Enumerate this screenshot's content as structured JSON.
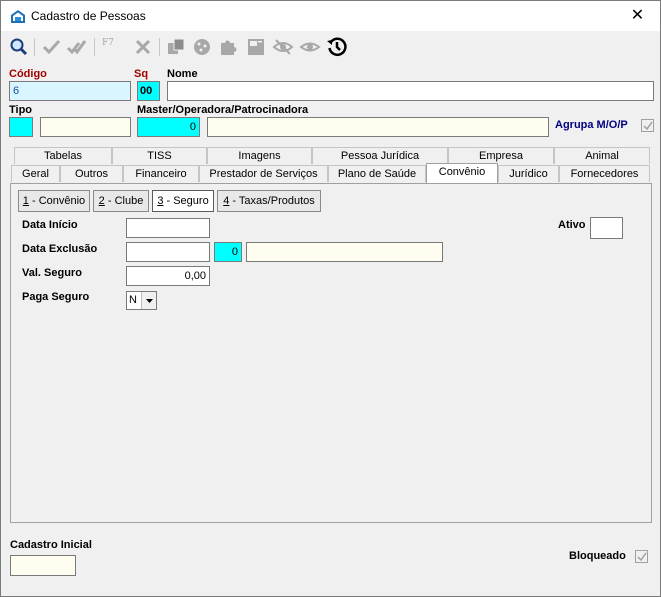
{
  "window": {
    "title": "Cadastro de Pessoas",
    "close_glyph": "✕"
  },
  "toolbar": {
    "items": [
      "search-icon",
      "check-icon",
      "double-check-icon",
      "f7-icon",
      "cancel-icon",
      "copy-icon",
      "cookie-icon",
      "puzzle-icon",
      "document-icon",
      "eye-slash-icon",
      "eye-icon",
      "history-icon"
    ],
    "f7_label": "F7"
  },
  "header": {
    "codigo_label": "Código",
    "codigo_value": "6",
    "sq_label": "Sq",
    "sq_value": "00",
    "nome_label": "Nome",
    "nome_value": "",
    "tipo_label": "Tipo",
    "master_label": "Master/Operadora/Patrocinadora",
    "master_code": "0",
    "master_name": "",
    "agrupa_label": "Agrupa M/O/P",
    "agrupa_checked": true
  },
  "tabs_top": [
    "Tabelas",
    "TISS",
    "Imagens",
    "Pessoa Jurídica",
    "Empresa",
    "Animal"
  ],
  "tabs_bottom": [
    "Geral",
    "Outros",
    "Financeiro",
    "Prestador de Serviços",
    "Plano de Saúde",
    "Convênio",
    "Jurídico",
    "Fornecedores"
  ],
  "active_tab": "Convênio",
  "subtabs": [
    {
      "key": "1",
      "label": " - Convênio"
    },
    {
      "key": "2",
      "label": " - Clube"
    },
    {
      "key": "3",
      "label": " - Seguro"
    },
    {
      "key": "4",
      "label": " - Taxas/Produtos"
    }
  ],
  "active_subtab": "3 - Seguro",
  "form": {
    "data_inicio_label": "Data Início",
    "data_inicio_value": "",
    "ativo_label": "Ativo",
    "ativo_value": "",
    "data_exclusao_label": "Data Exclusão",
    "data_exclusao_value": "",
    "exclusao_code": "0",
    "exclusao_desc": "",
    "val_seguro_label": "Val. Seguro",
    "val_seguro_value": "0,00",
    "paga_seguro_label": "Paga Seguro",
    "paga_seguro_value": "N"
  },
  "footer": {
    "cadastro_inicial_label": "Cadastro Inicial",
    "cadastro_inicial_value": "",
    "bloqueado_label": "Bloqueado",
    "bloqueado_checked": true
  },
  "colors": {
    "cyan": "#00ffff",
    "cream": "#fffdf0",
    "code_red": "#a00000",
    "navy": "#000080"
  }
}
